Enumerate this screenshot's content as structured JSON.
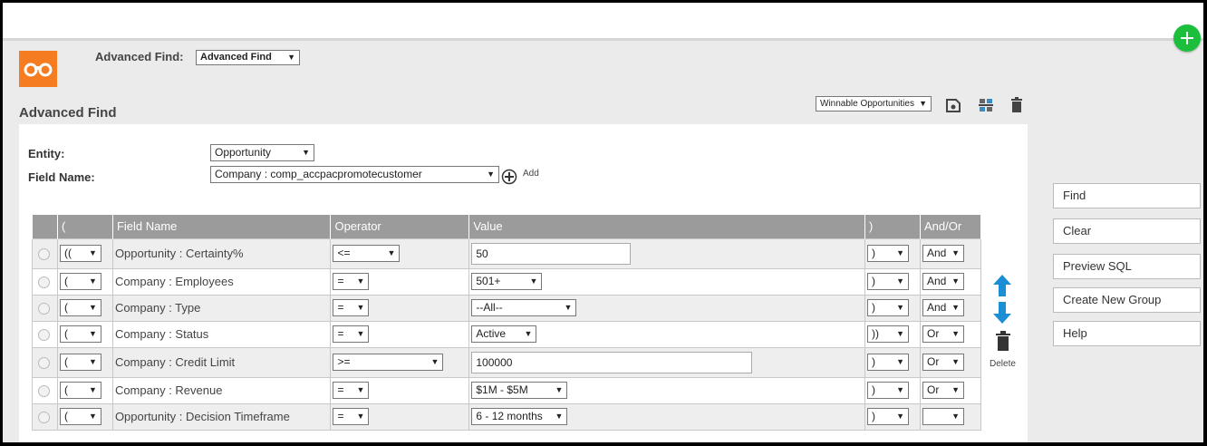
{
  "header": {
    "advanced_find_label": "Advanced Find:",
    "advanced_find_value": "Advanced Find",
    "page_title": "Advanced Find",
    "saved_search_value": "Winnable Opportunities"
  },
  "form": {
    "entity_label": "Entity:",
    "entity_value": "Opportunity",
    "field_name_label": "Field Name:",
    "field_name_value": "Company : comp_accpacpromotecustomer",
    "add_label": "Add"
  },
  "grid": {
    "headers": [
      "",
      "(",
      "Field Name",
      "Operator",
      "Value",
      ")",
      "And/Or"
    ],
    "rows": [
      {
        "open": "((",
        "field": "Opportunity : Certainty%",
        "operator": "<=",
        "value": "50",
        "value_type": "input",
        "close": ")",
        "andor": "And"
      },
      {
        "open": "(",
        "field": "Company : Employees",
        "operator": "=",
        "value": "501+",
        "value_type": "select",
        "close": ")",
        "andor": "And"
      },
      {
        "open": "(",
        "field": "Company : Type",
        "operator": "=",
        "value": "--All--",
        "value_type": "select",
        "close": ")",
        "andor": "And"
      },
      {
        "open": "(",
        "field": "Company : Status",
        "operator": "=",
        "value": "Active",
        "value_type": "select",
        "close": "))",
        "andor": "Or"
      },
      {
        "open": "(",
        "field": "Company : Credit Limit",
        "operator": ">=",
        "value": "100000",
        "value_type": "input",
        "close": ")",
        "andor": "Or"
      },
      {
        "open": "(",
        "field": "Company : Revenue",
        "operator": "=",
        "value": "$1M - $5M",
        "value_type": "select",
        "close": ")",
        "andor": "Or"
      },
      {
        "open": "(",
        "field": "Opportunity : Decision Timeframe",
        "operator": "=",
        "value": "6 - 12 months",
        "value_type": "select",
        "close": ")",
        "andor": ""
      }
    ]
  },
  "side": {
    "delete_label": "Delete",
    "buttons": [
      "Find",
      "Clear",
      "Preview SQL",
      "Create New Group",
      "Help"
    ]
  },
  "colors": {
    "accent_orange": "#f57c20",
    "plus_green": "#1bbf3b",
    "arrow_blue": "#1a8fd6",
    "header_gray": "#9b9b9b"
  },
  "icons": {
    "logo": "binoculars-icon",
    "plus": "plus-icon",
    "save": "save-search-icon",
    "group": "group-icon",
    "trash": "trash-icon",
    "up": "arrow-up-icon",
    "down": "arrow-down-icon",
    "add": "add-circle-icon"
  }
}
